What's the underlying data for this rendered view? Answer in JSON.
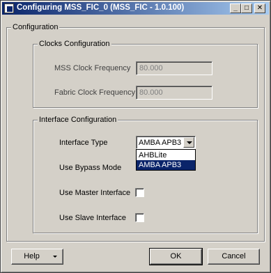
{
  "window": {
    "title": "Configuring MSS_FIC_0 (MSS_FIC - 1.0.100)",
    "minimize_glyph": "_",
    "maximize_glyph": "□",
    "close_glyph": "✕"
  },
  "configuration": {
    "label": "Configuration",
    "clocks": {
      "label": "Clocks Configuration",
      "mss_clock_label": "MSS Clock Frequency",
      "mss_clock_value": "80.000",
      "fabric_clock_label": "Fabric Clock Frequency",
      "fabric_clock_value": "80.000"
    },
    "interface": {
      "label": "Interface Configuration",
      "type_label": "Interface Type",
      "type_value": "AMBA APB3",
      "type_options": [
        "AHBLite",
        "AMBA APB3"
      ],
      "bypass_label": "Use Bypass Mode",
      "master_label": "Use Master Interface",
      "master_checked": false,
      "slave_label": "Use Slave Interface",
      "slave_checked": false
    }
  },
  "buttons": {
    "help": "Help",
    "ok": "OK",
    "cancel": "Cancel"
  }
}
